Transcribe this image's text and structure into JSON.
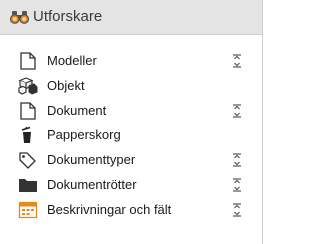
{
  "panel": {
    "title": "Utforskare",
    "icon": "binoculars-icon"
  },
  "items": [
    {
      "label": "Modeller",
      "icon": "document-outline-icon"
    },
    {
      "label": "Objekt",
      "icon": "cubes-icon"
    },
    {
      "label": "Dokument",
      "icon": "document-outline-icon"
    },
    {
      "label": "Papperskorg",
      "icon": "trash-icon"
    },
    {
      "label": "Dokumenttyper",
      "icon": "tag-icon"
    },
    {
      "label": "Dokumentrötter",
      "icon": "folder-icon"
    },
    {
      "label": "Beskrivningar och fält",
      "icon": "calendar-icon"
    }
  ],
  "expand_icon": "expand-collapse-icon",
  "colors": {
    "header_bg": "#e4e4e4",
    "calendar_accent": "#e8891c"
  }
}
